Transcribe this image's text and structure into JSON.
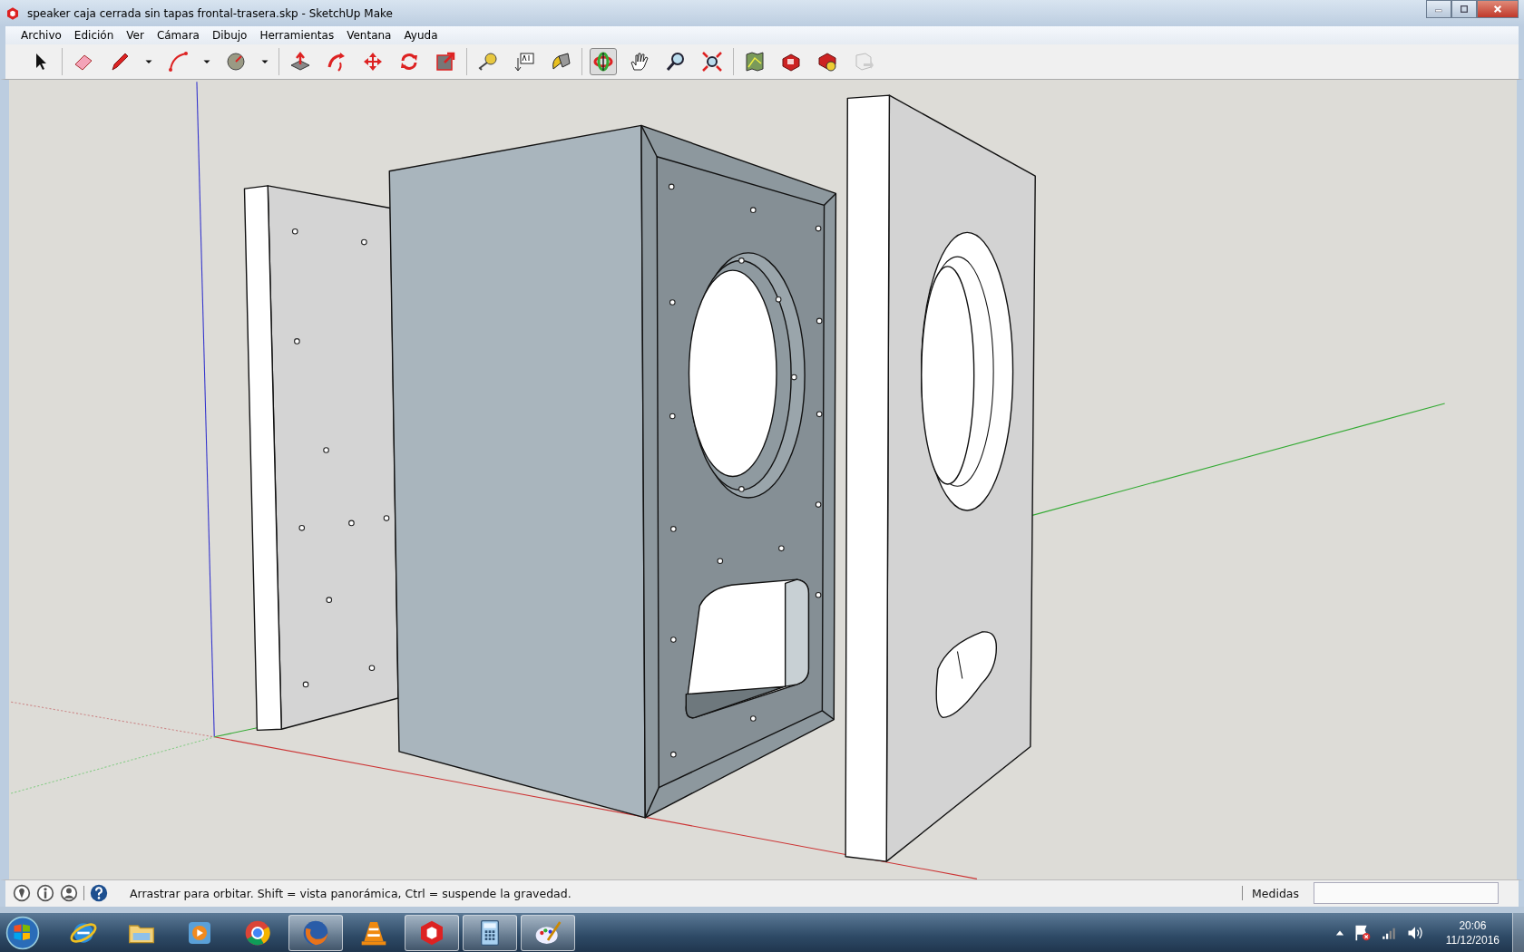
{
  "window": {
    "title": "speaker caja cerrada sin tapas frontal-trasera.skp - SketchUp Make"
  },
  "menu": [
    "Archivo",
    "Edición",
    "Ver",
    "Cámara",
    "Dibujo",
    "Herramientas",
    "Ventana",
    "Ayuda"
  ],
  "toolbar": [
    [
      {
        "kind": "select",
        "selected": false
      }
    ],
    [
      {
        "kind": "eraser",
        "selected": false
      },
      {
        "kind": "pencil",
        "selected": false
      },
      {
        "kind": "caret",
        "selected": false
      },
      {
        "kind": "arc",
        "selected": false
      },
      {
        "kind": "caret",
        "selected": false
      },
      {
        "kind": "circle",
        "selected": false
      },
      {
        "kind": "caret",
        "selected": false
      }
    ],
    [
      {
        "kind": "pushpull",
        "selected": false
      },
      {
        "kind": "followme",
        "selected": false
      },
      {
        "kind": "move",
        "selected": false
      },
      {
        "kind": "rotate",
        "selected": false
      },
      {
        "kind": "scale",
        "selected": false
      }
    ],
    [
      {
        "kind": "tape",
        "selected": false
      },
      {
        "kind": "text",
        "selected": false
      },
      {
        "kind": "paint",
        "selected": false
      }
    ],
    [
      {
        "kind": "orbit",
        "selected": true
      },
      {
        "kind": "pan",
        "selected": false
      },
      {
        "kind": "zoom",
        "selected": false
      },
      {
        "kind": "extents",
        "selected": false
      }
    ],
    [
      {
        "kind": "map",
        "selected": false
      },
      {
        "kind": "warehouse",
        "selected": false
      },
      {
        "kind": "share",
        "selected": false
      },
      {
        "kind": "faded",
        "selected": false
      }
    ]
  ],
  "status_bar": {
    "icons": [
      {
        "kind": "pin"
      },
      {
        "kind": "info"
      },
      {
        "kind": "person"
      },
      {
        "kind": "help"
      }
    ],
    "message": "Arrastrar para orbitar. Shift = vista panorámica, Ctrl = suspende la gravedad.",
    "measurements_label": "Medidas"
  },
  "taskbar": {
    "apps": [
      {
        "kind": "ie",
        "running": false
      },
      {
        "kind": "folder",
        "running": false
      },
      {
        "kind": "media",
        "running": false
      },
      {
        "kind": "chrome",
        "running": false
      },
      {
        "kind": "firefox",
        "running": true
      },
      {
        "kind": "vlc",
        "running": false
      },
      {
        "kind": "sketchup",
        "running": true
      },
      {
        "kind": "calculator",
        "running": true
      },
      {
        "kind": "paint",
        "running": true
      }
    ],
    "clock_time": "20:06",
    "clock_date": "11/12/2016"
  }
}
